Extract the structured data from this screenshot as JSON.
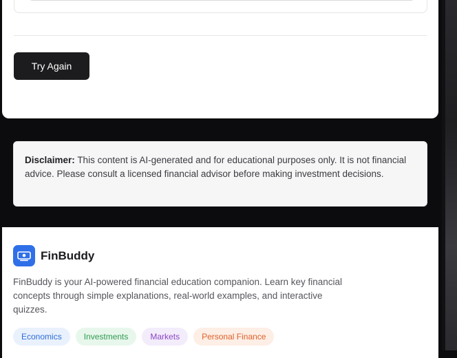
{
  "actions": {
    "try_again_label": "Try Again"
  },
  "disclaimer": {
    "label": "Disclaimer:",
    "text": "This content is AI-generated and for educational purposes only. It is not financial advice. Please consult a licensed financial advisor before making investment decisions."
  },
  "footer": {
    "brand_name": "FinBuddy",
    "brand_icon": "money-icon",
    "description": "FinBuddy is your AI-powered financial education companion. Learn key financial concepts through simple explanations, real-world examples, and interactive quizzes.",
    "tags": [
      {
        "label": "Economics",
        "color": "#2d6bd8"
      },
      {
        "label": "Investments",
        "color": "#2f9a50"
      },
      {
        "label": "Markets",
        "color": "#8a45c7"
      },
      {
        "label": "Personal Finance",
        "color": "#e06127"
      }
    ]
  },
  "colors": {
    "brand_accent": "#2f6fe8",
    "button_bg": "#1c1c1e",
    "page_bg": "#0c0c0e"
  }
}
